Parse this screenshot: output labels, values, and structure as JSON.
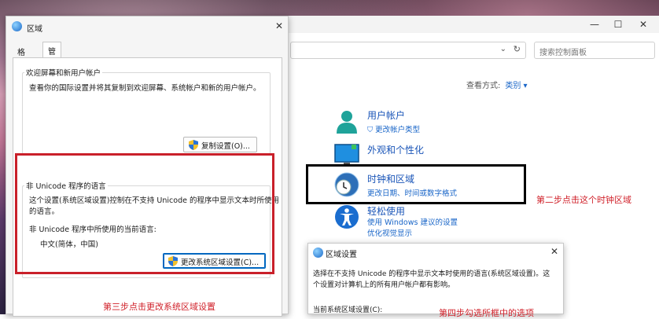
{
  "control_panel": {
    "search_placeholder": "搜索控制面板",
    "view_by_label": "查看方式:",
    "view_by_value": "类别 ▾",
    "categories": [
      {
        "title": "用户帐户",
        "links": [
          "更改帐户类型"
        ]
      },
      {
        "title": "外观和个性化",
        "links": []
      },
      {
        "title": "时钟和区域",
        "links": [
          "更改日期、时间或数字格式"
        ]
      },
      {
        "title": "轻松使用",
        "links": [
          "使用 Windows 建议的设置",
          "优化视觉显示"
        ]
      }
    ],
    "window_controls": {
      "minimize": "—",
      "maximize": "☐",
      "close": "✕"
    }
  },
  "annotations": {
    "step2": "第二步点击这个时钟区域",
    "step3": "第三步点击更改系统区域设置",
    "step4": "第四步勾选所框中的选项"
  },
  "region_dialog": {
    "title": "区域",
    "close": "✕",
    "tabs": [
      "格式",
      "管理"
    ],
    "welcome_group": {
      "label": "欢迎屏幕和新用户帐户",
      "desc": "查看你的国际设置并将其复制到欢迎屏幕、系统帐户和新的用户帐户。",
      "button": "复制设置(O)..."
    },
    "unicode_group": {
      "label": "非 Unicode 程序的语言",
      "desc_line1": "这个设置(系统区域设置)控制在不支持 Unicode 的程序中显示文本时所使用",
      "desc_line2": "的语言。",
      "current_label": "非 Unicode 程序中所使用的当前语言:",
      "current_value": "中文(简体，中国)",
      "button": "更改系统区域设置(C)..."
    }
  },
  "region_settings_dialog": {
    "title": "区域设置",
    "close": "✕",
    "line1": "选择在不支持 Unicode 的程序中显示文本时使用的语言(系统区域设置)。这",
    "line2": "个设置对计算机上的所有用户帐户都有影响。",
    "current_label": "当前系统区域设置(C):"
  },
  "colors": {
    "accent": "#1a66c8",
    "annotation_red": "#d0212a",
    "highlight_black": "#000000"
  }
}
